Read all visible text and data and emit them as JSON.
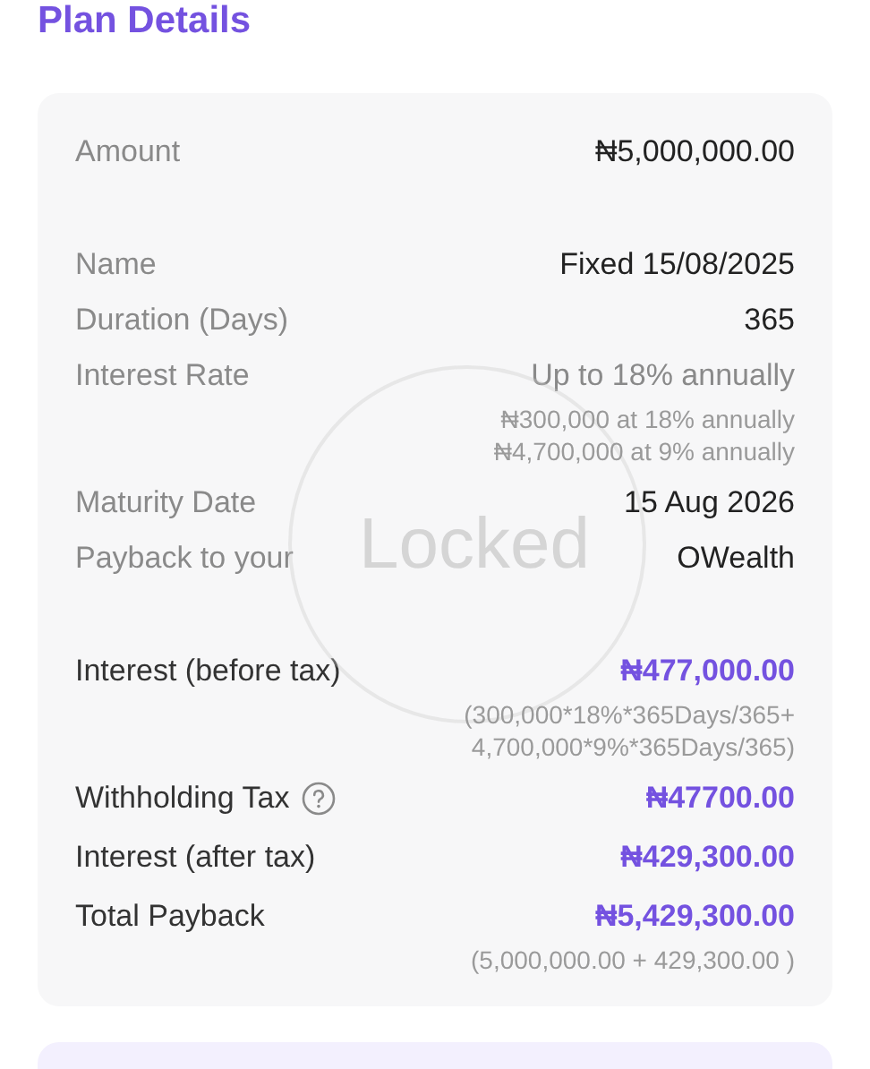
{
  "title": "Plan Details",
  "stamp": "Locked",
  "sections": [
    [
      {
        "kind": "plain",
        "label": "Amount",
        "value": "₦5,000,000.00"
      }
    ],
    [
      {
        "kind": "plain",
        "label": "Name",
        "value": "Fixed 15/08/2025"
      },
      {
        "kind": "plain",
        "label": "Duration (Days)",
        "value": "365"
      },
      {
        "kind": "muted",
        "label": "Interest Rate",
        "value": "Up to 18% annually",
        "notes": [
          "₦300,000 at 18% annually",
          "₦4,700,000 at 9% annually"
        ]
      },
      {
        "kind": "plain",
        "label": "Maturity Date",
        "value": "15 Aug 2026"
      },
      {
        "kind": "plain",
        "label": "Payback to your",
        "value": "OWealth"
      }
    ],
    [
      {
        "kind": "highlight",
        "label": "Interest (before tax)",
        "value": "₦477,000.00",
        "notes": [
          "(300,000*18%*365Days/365+",
          "4,700,000*9%*365Days/365)"
        ]
      },
      {
        "kind": "highlight",
        "label": "Withholding Tax",
        "help": true,
        "value": "₦47700.00"
      },
      {
        "kind": "highlight",
        "label": "Interest (after tax)",
        "value": "₦429,300.00"
      },
      {
        "kind": "highlight",
        "label": "Total Payback",
        "value": "₦5,429,300.00",
        "notes": [
          "(5,000,000.00 + 429,300.00 )"
        ]
      }
    ]
  ]
}
